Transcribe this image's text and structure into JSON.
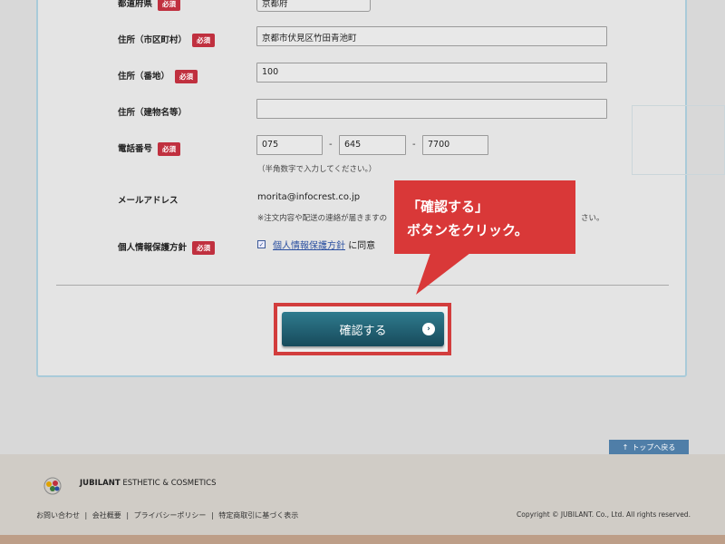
{
  "form": {
    "prefecture": {
      "label": "都道府県",
      "required": "必須",
      "value": "京都府"
    },
    "city": {
      "label": "住所（市区町村）",
      "required": "必須",
      "value": "京都市伏見区竹田青池町"
    },
    "street": {
      "label": "住所（番地）",
      "required": "必須",
      "value": "100"
    },
    "building": {
      "label": "住所（建物名等）",
      "value": ""
    },
    "phone": {
      "label": "電話番号",
      "required": "必須",
      "part1": "075",
      "part2": "645",
      "part3": "7700",
      "dash": "-",
      "note": "（半角数字で入力してください。）"
    },
    "email": {
      "label": "メールアドレス",
      "value": "morita@infocrest.co.jp",
      "note_left": "※注文内容や配送の連絡が届きますの",
      "note_right": "さい。"
    },
    "privacy": {
      "label": "個人情報保護方針",
      "required": "必須",
      "link": "個人情報保護方針",
      "suffix": "に同意",
      "checked": true
    }
  },
  "confirm_button": {
    "label": "確認する",
    "icon": "chevron-right-icon"
  },
  "callout": {
    "line1": "「確認する」",
    "line2": "ボタンをクリック。",
    "color": "#d93838"
  },
  "to_top": {
    "label": "トップへ戻る",
    "icon": "arrow-up-icon"
  },
  "footer": {
    "brand_bold": "JUBILANT",
    "brand_rest": " ESTHETIC & COSMETICS",
    "nav": [
      "お問い合わせ",
      "会社概要",
      "プライバシーポリシー",
      "特定商取引に基づく表示"
    ],
    "separator": "|",
    "copyright": "Copyright © JUBILANT. Co., Ltd. All rights reserved."
  },
  "colors": {
    "accent": "#174a5b",
    "required_badge": "#c0303f",
    "highlight": "#d23d3d",
    "link": "#2a4fa0"
  }
}
